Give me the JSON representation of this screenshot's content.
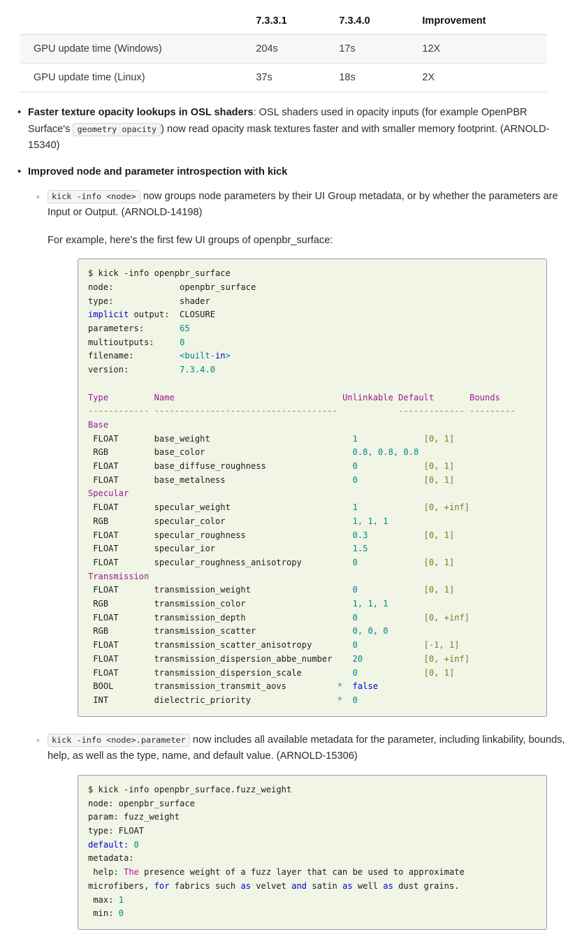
{
  "perf_table": {
    "headers": [
      "",
      "7.3.3.1",
      "7.3.4.0",
      "Improvement"
    ],
    "rows": [
      {
        "label": "GPU update time (Windows)",
        "v1": "204s",
        "v2": "17s",
        "improvement": "12X"
      },
      {
        "label": "GPU update time (Linux)",
        "v1": "37s",
        "v2": "18s",
        "improvement": "2X"
      }
    ]
  },
  "bullets": {
    "opacity": {
      "lead": "Faster texture opacity lookups in OSL shaders",
      "text_before": ": OSL shaders used in opacity inputs (for example OpenPBR Surface's",
      "inline_code": "geometry opacity",
      "text_after": ") now read opacity mask textures faster and with smaller memory footprint. (ARNOLD-15340)"
    },
    "introspection": {
      "lead": "Improved node and parameter introspection with kick",
      "sub1": {
        "inline_code": "kick -info <node>",
        "text": "now groups node parameters by their UI Group metadata, or by whether the parameters are Input or Output. (ARNOLD-14198)",
        "example_intro": "For example, here's the first few UI groups of openpbr_surface:"
      },
      "sub2": {
        "inline_code": "kick -info <node>.parameter",
        "text": "now includes all available metadata for the parameter, including linkability, bounds, help, as well as the type, name, and default value. (ARNOLD-15306)"
      }
    }
  },
  "code_block_1": {
    "command": "$ kick -info openpbr_surface",
    "info": [
      {
        "key": "node:",
        "key_kw": false,
        "value": "openpbr_surface",
        "value_type": "plain"
      },
      {
        "key": "type:",
        "key_kw": false,
        "value": "shader",
        "value_type": "plain"
      },
      {
        "key": "implicit output:",
        "key_kw": true,
        "value": "CLOSURE",
        "value_type": "plain"
      },
      {
        "key": "parameters:",
        "key_kw": false,
        "value": "65",
        "value_type": "num"
      },
      {
        "key": "multioutputs:",
        "key_kw": false,
        "value": "0",
        "value_type": "num"
      },
      {
        "key": "filename:",
        "key_kw": false,
        "value": "<built-in>",
        "value_type": "builtin"
      },
      {
        "key": "version:",
        "key_kw": false,
        "value": "7.3.4.0",
        "value_type": "num"
      }
    ],
    "columns": [
      "Type",
      "Name",
      "Unlinkable",
      "Default",
      "Bounds"
    ],
    "separators": [
      "------------",
      "------------------------------------",
      "-------------",
      "---------"
    ],
    "groups": [
      {
        "name": "Base",
        "params": [
          {
            "type": "FLOAT",
            "name": "base_weight",
            "unlinkable": "",
            "default": "1",
            "bounds": "[0, 1]"
          },
          {
            "type": "RGB",
            "name": "base_color",
            "unlinkable": "",
            "default": "0.8, 0.8, 0.8",
            "bounds": ""
          },
          {
            "type": "FLOAT",
            "name": "base_diffuse_roughness",
            "unlinkable": "",
            "default": "0",
            "bounds": "[0, 1]"
          },
          {
            "type": "FLOAT",
            "name": "base_metalness",
            "unlinkable": "",
            "default": "0",
            "bounds": "[0, 1]"
          }
        ]
      },
      {
        "name": "Specular",
        "params": [
          {
            "type": "FLOAT",
            "name": "specular_weight",
            "unlinkable": "",
            "default": "1",
            "bounds": "[0, +inf]"
          },
          {
            "type": "RGB",
            "name": "specular_color",
            "unlinkable": "",
            "default": "1, 1, 1",
            "bounds": ""
          },
          {
            "type": "FLOAT",
            "name": "specular_roughness",
            "unlinkable": "",
            "default": "0.3",
            "bounds": "[0, 1]"
          },
          {
            "type": "FLOAT",
            "name": "specular_ior",
            "unlinkable": "",
            "default": "1.5",
            "bounds": ""
          },
          {
            "type": "FLOAT",
            "name": "specular_roughness_anisotropy",
            "unlinkable": "",
            "default": "0",
            "bounds": "[0, 1]"
          }
        ]
      },
      {
        "name": "Transmission",
        "params": [
          {
            "type": "FLOAT",
            "name": "transmission_weight",
            "unlinkable": "",
            "default": "0",
            "bounds": "[0, 1]"
          },
          {
            "type": "RGB",
            "name": "transmission_color",
            "unlinkable": "",
            "default": "1, 1, 1",
            "bounds": ""
          },
          {
            "type": "FLOAT",
            "name": "transmission_depth",
            "unlinkable": "",
            "default": "0",
            "bounds": "[0, +inf]"
          },
          {
            "type": "RGB",
            "name": "transmission_scatter",
            "unlinkable": "",
            "default": "0, 0, 0",
            "bounds": ""
          },
          {
            "type": "FLOAT",
            "name": "transmission_scatter_anisotropy",
            "unlinkable": "",
            "default": "0",
            "bounds": "[-1, 1]"
          },
          {
            "type": "FLOAT",
            "name": "transmission_dispersion_abbe_number",
            "unlinkable": "",
            "default": "20",
            "bounds": "[0, +inf]"
          },
          {
            "type": "FLOAT",
            "name": "transmission_dispersion_scale",
            "unlinkable": "",
            "default": "0",
            "bounds": "[0, 1]"
          },
          {
            "type": "BOOL",
            "name": "transmission_transmit_aovs",
            "unlinkable": "*",
            "default": "false",
            "bounds": "",
            "default_type": "kw"
          },
          {
            "type": "INT",
            "name": "dielectric_priority",
            "unlinkable": "*",
            "default": "0",
            "bounds": ""
          }
        ]
      }
    ]
  },
  "code_block_2": {
    "command": "$ kick -info openpbr_surface.fuzz_weight",
    "lines": [
      {
        "key": "node:",
        "value": "openpbr_surface"
      },
      {
        "key": "param:",
        "value": "fuzz_weight"
      },
      {
        "key": "type:",
        "value": "FLOAT"
      },
      {
        "key": "default:",
        "value": "0",
        "key_kw": true,
        "value_type": "num"
      },
      {
        "key": "metadata:",
        "value": ""
      }
    ],
    "help_label": "help:",
    "help_text": "The presence weight of a fuzz layer that can be used to approximate microfibers, for fabrics such as velvet and satin as well as dust grains.",
    "metadata": [
      {
        "key": "max:",
        "value": "1"
      },
      {
        "key": "min:",
        "value": "0"
      }
    ]
  },
  "colors": {
    "codeblock_bg": "#f0f5e6",
    "codeblock_border": "#9a9a9a",
    "keyword": "#0000cf",
    "number": "#008585",
    "header": "#9b1a8f",
    "bounds": "#7a7a1f",
    "string": "#b3179b",
    "inline_code_bg": "#f4f4f4",
    "table_stripe": "#f7f7f7"
  }
}
